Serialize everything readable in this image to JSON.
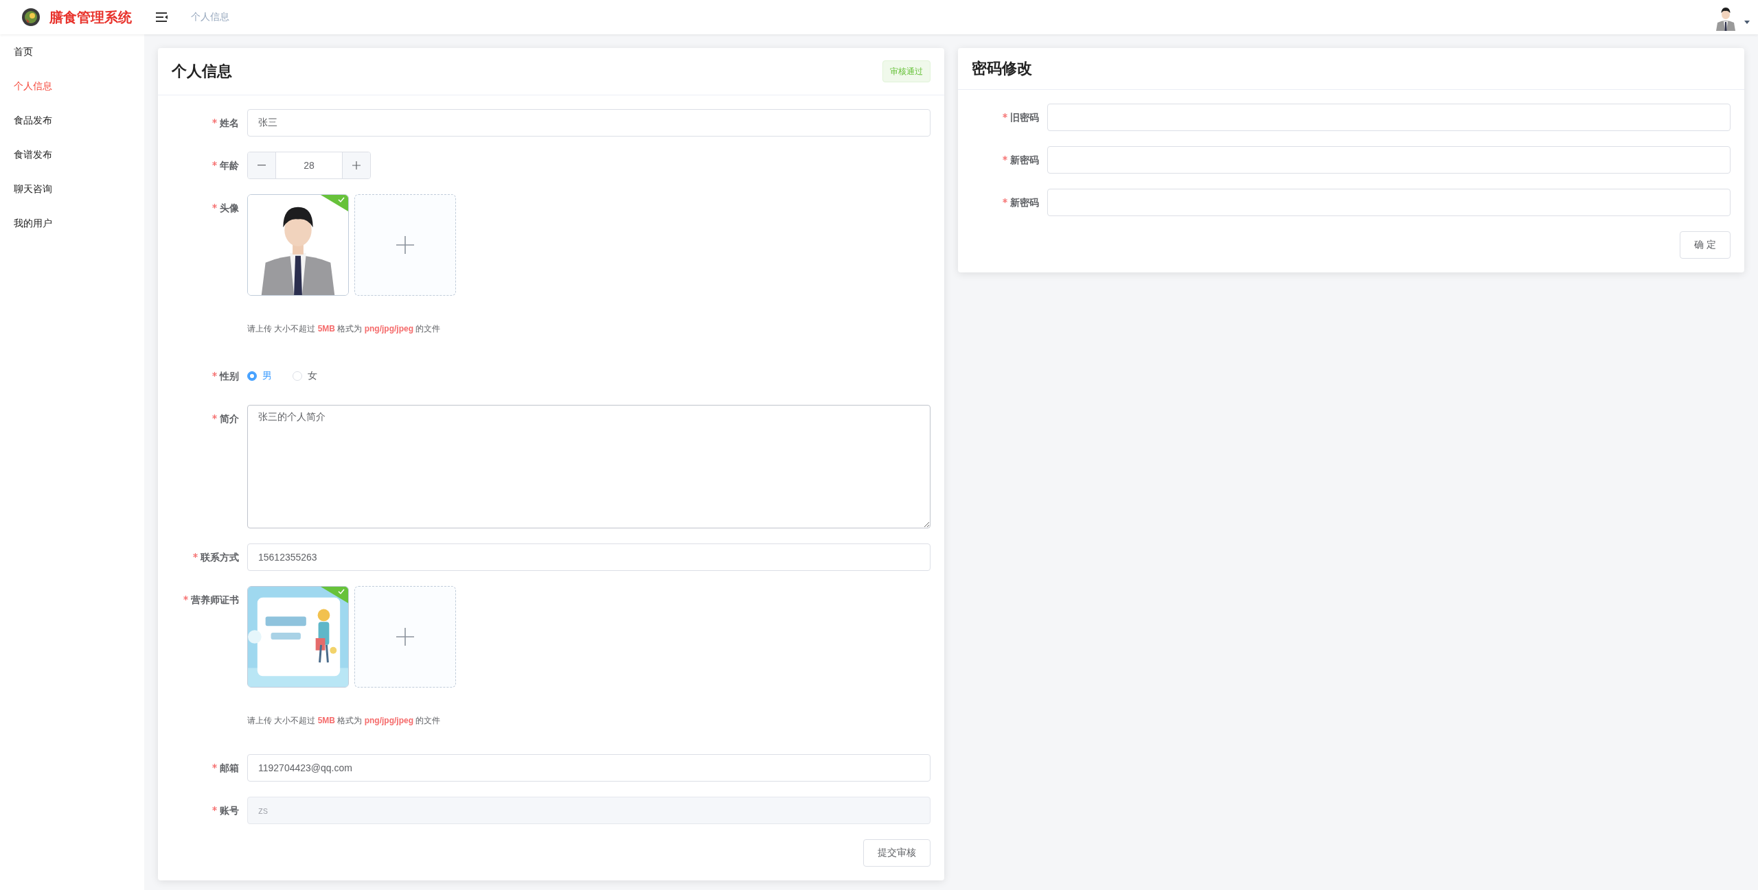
{
  "app": {
    "title": "膳食管理系统"
  },
  "breadcrumb": "个人信息",
  "sidebar": {
    "items": [
      {
        "label": "首页",
        "selected": false
      },
      {
        "label": "个人信息",
        "selected": true
      },
      {
        "label": "食品发布",
        "selected": false
      },
      {
        "label": "食谱发布",
        "selected": false
      },
      {
        "label": "聊天咨询",
        "selected": false
      },
      {
        "label": "我的用户",
        "selected": false
      }
    ]
  },
  "profile": {
    "title": "个人信息",
    "status": "审核通过",
    "fields": [
      {
        "kind": "text",
        "label": "姓名",
        "required": true,
        "value": "张三",
        "disabled": false
      },
      {
        "kind": "number",
        "label": "年龄",
        "required": true,
        "value": "28"
      },
      {
        "kind": "upload",
        "label": "头像",
        "required": true,
        "files": [
          {
            "kind": "picture",
            "uploaded": true
          }
        ],
        "hint": "请上传 大小不超过 **5MB** 格式为 **png/jpg/jpeg** 的文件"
      },
      {
        "kind": "radio",
        "label": "性别",
        "required": true,
        "options": [
          {
            "label": "男",
            "selected": true
          },
          {
            "label": "女",
            "selected": false
          }
        ]
      },
      {
        "kind": "textarea",
        "label": "简介",
        "required": true,
        "value": "张三的个人简介"
      },
      {
        "kind": "text",
        "label": "联系方式",
        "required": true,
        "value": "15612355263",
        "disabled": false
      },
      {
        "kind": "upload",
        "label": "营养师证书",
        "required": true,
        "files": [
          {
            "kind": "picture",
            "uploaded": true
          }
        ],
        "hint": "请上传 大小不超过 **5MB** 格式为 **png/jpg/jpeg** 的文件"
      },
      {
        "kind": "text",
        "label": "邮箱",
        "required": true,
        "value": "1192704423@qq.com",
        "disabled": false
      },
      {
        "kind": "text",
        "label": "账号",
        "required": true,
        "value": "zs",
        "disabled": true
      }
    ],
    "submit": "提交审核"
  },
  "password": {
    "title": "密码修改",
    "fields": [
      {
        "label": "旧密码",
        "required": true
      },
      {
        "label": "新密码",
        "required": true
      },
      {
        "label": "新密码",
        "required": true
      }
    ],
    "submit": "确 定"
  }
}
